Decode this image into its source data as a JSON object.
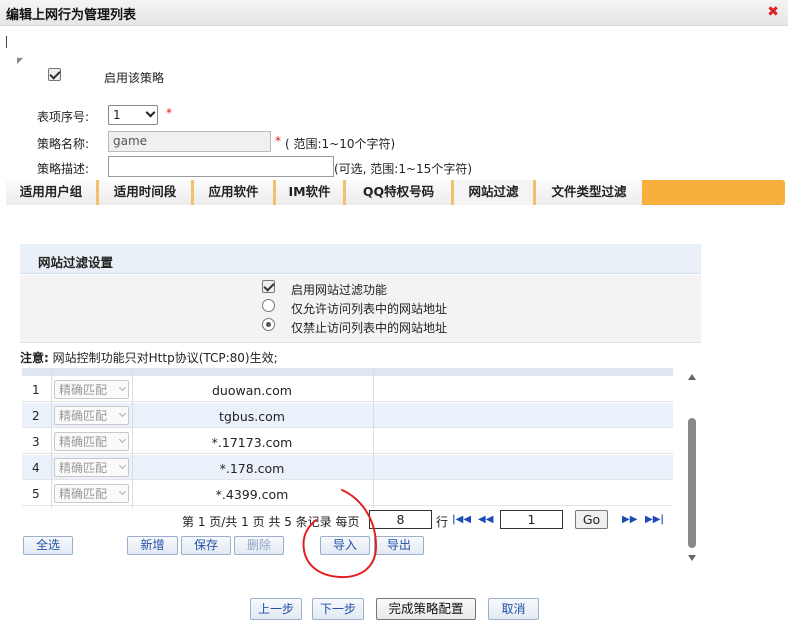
{
  "window": {
    "title": "编辑上网行为管理列表"
  },
  "policy": {
    "enable_label": "启用该策略",
    "index_label": "表项序号:",
    "index_value": "1",
    "required_mark": "*",
    "name_label": "策略名称:",
    "name_value": "game",
    "name_hint": "( 范围:1~10个字符)",
    "desc_label": "策略描述:",
    "desc_value": "",
    "desc_hint": "(可选, 范围:1~15个字符)"
  },
  "tabs": [
    {
      "label": "适用用户组"
    },
    {
      "label": "适用时间段"
    },
    {
      "label": "应用软件"
    },
    {
      "label": "IM软件"
    },
    {
      "label": "QQ特权号码"
    },
    {
      "label": "网站过滤"
    },
    {
      "label": "文件类型过滤"
    }
  ],
  "filter": {
    "section_title": "网站过滤设置",
    "enable_label": "启用网站过滤功能",
    "allow_label": "仅允许访问列表中的网站地址",
    "deny_label": "仅禁止访问列表中的网站地址",
    "note_prefix": "注意:",
    "note_text": "网站控制功能只对Http协议(TCP:80)生效;"
  },
  "rows": [
    {
      "num": "1",
      "match": "精确匹配",
      "site": "duowan.com"
    },
    {
      "num": "2",
      "match": "精确匹配",
      "site": "tgbus.com"
    },
    {
      "num": "3",
      "match": "精确匹配",
      "site": "*.17173.com"
    },
    {
      "num": "4",
      "match": "精确匹配",
      "site": "*.178.com"
    },
    {
      "num": "5",
      "match": "精确匹配",
      "site": "*.4399.com"
    }
  ],
  "pager": {
    "summary": "第 1 页/共 1 页 共 5 条记录 每页",
    "per_page": "8",
    "rows_unit": "行",
    "page_value": "1",
    "go_label": "Go"
  },
  "actions": {
    "select_all": "全选",
    "add": "新增",
    "save": "保存",
    "delete": "删除",
    "import": "导入",
    "export": "导出"
  },
  "footer": {
    "prev": "上一步",
    "next": "下一步",
    "finish": "完成策略配置",
    "cancel": "取消"
  },
  "colors": {
    "tab_accent": "#f7b03d",
    "annotation_red": "#e02020",
    "link_blue": "#2250a8"
  }
}
